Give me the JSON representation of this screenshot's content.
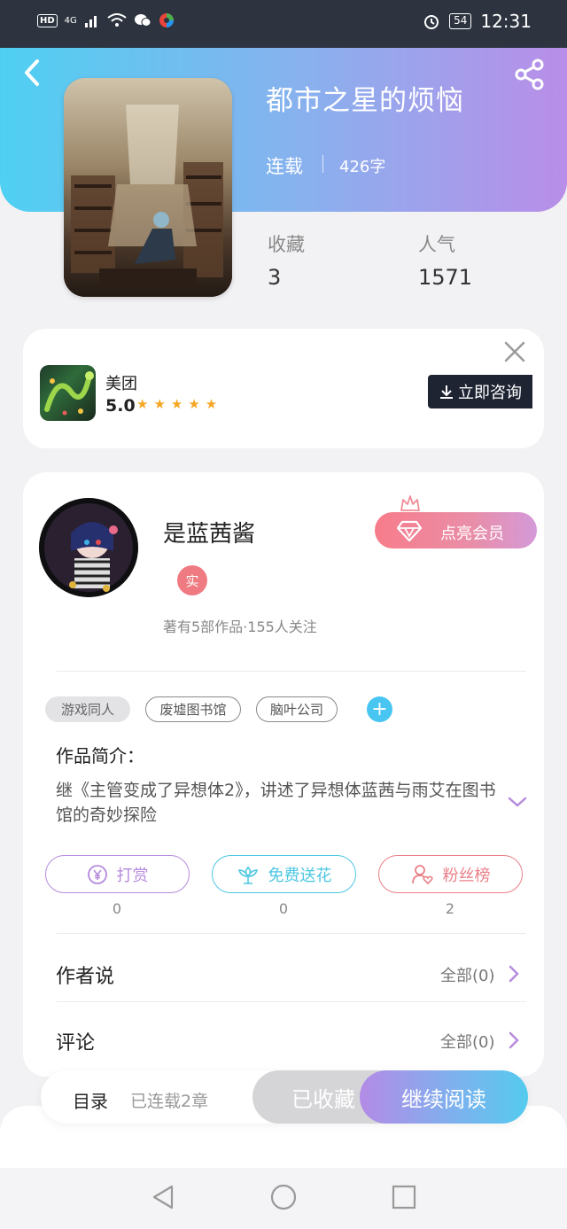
{
  "status_bar": {
    "hd": "HD",
    "network": "4G",
    "battery": "54",
    "time": "12:31"
  },
  "book": {
    "title": "都市之星的烦恼",
    "status": "连载",
    "word_count": "426字",
    "stats": [
      {
        "label": "收藏",
        "value": "3"
      },
      {
        "label": "人气",
        "value": "1571"
      }
    ]
  },
  "ad": {
    "app_name": "美团",
    "rating": "5.0",
    "stars": "★★★★★",
    "cta": "立即咨询"
  },
  "author": {
    "name": "是蓝茜酱",
    "badge": "实",
    "meta": "著有5部作品·155人关注",
    "vip_button": "点亮会员"
  },
  "tags": [
    "游戏同人",
    "废墟图书馆",
    "脑叶公司"
  ],
  "tag_add": "+",
  "intro": {
    "label": "作品简介：",
    "text": "继《主管变成了异想体2》，讲述了异想体蓝茜与雨艾在图书馆的奇妙探险"
  },
  "actions": [
    {
      "label": "打赏",
      "count": "0",
      "color": "#b68bdd",
      "icon": "yen-icon"
    },
    {
      "label": "免费送花",
      "count": "0",
      "color": "#4cc7e2",
      "icon": "flower-icon"
    },
    {
      "label": "粉丝榜",
      "count": "2",
      "color": "#e98088",
      "icon": "fan-icon"
    }
  ],
  "rows": [
    {
      "label": "作者说",
      "right": "全部(0)"
    },
    {
      "label": "评论",
      "right": "全部(0)"
    }
  ],
  "bottom": {
    "toc": "目录",
    "toc_sub": "已连载2章",
    "collected": "已收藏",
    "read": "继续阅读"
  },
  "colors": {
    "accent_cyan": "#4fd0f2",
    "accent_purple": "#b98ee8",
    "vip_pink": "#f77c8a"
  }
}
